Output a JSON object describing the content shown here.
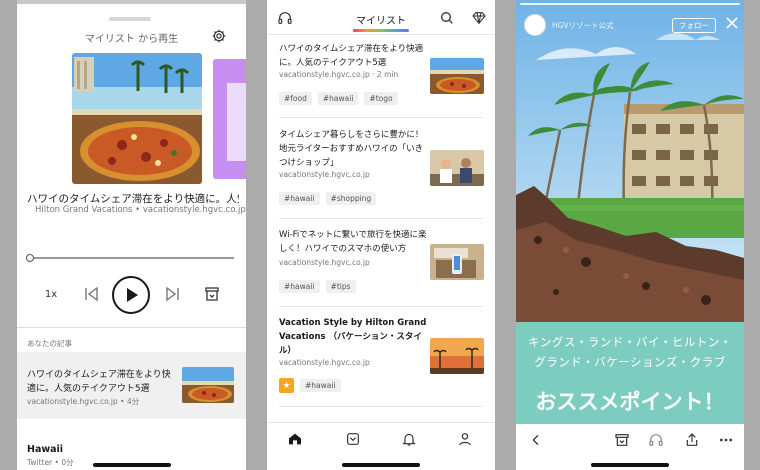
{
  "player": {
    "header_title": "マイリスト から再生",
    "track_title": "ハワイのタイムシェア滞在をより快適に。人気…",
    "track_source": "Hilton Grand Vacations • vacationstyle.hgvc.co.jp",
    "playback_fraction": 0.0,
    "speed_label": "1x",
    "section_label": "あなたの記事",
    "current_item": {
      "title": "ハワイのタイムシェア滞在をより快適に。人気のテイクアウト5選",
      "meta": "vacationstyle.hgvc.co.jp • 4分"
    },
    "next_item": {
      "title": "Hawaii",
      "meta": "Twitter • 0分"
    }
  },
  "list": {
    "title": "マイリスト",
    "items": [
      {
        "title": "ハワイのタイムシェア滞在をより快適に。人気のテイクアウト5選",
        "meta": "vacationstyle.hgvc.co.jp · 2 min",
        "tags": [
          "#food",
          "#hawaii",
          "#togo"
        ]
      },
      {
        "title": "タイムシェア暮らしをさらに豊かに！地元ライターおすすめハワイの「いきつけショップ」",
        "meta": "vacationstyle.hgvc.co.jp",
        "tags": [
          "#hawaii",
          "#shopping"
        ]
      },
      {
        "title": "Wi-Fiでネットに繋いで旅行を快適に楽しく！ハワイでのスマホの使い方",
        "meta": "vacationstyle.hgvc.co.jp",
        "tags": [
          "#hawaii",
          "#tips"
        ]
      },
      {
        "title": "Vacation Style by Hilton Grand Vacations （バケーション・スタイル）",
        "meta": "vacationstyle.hgvc.co.jp",
        "tags": [
          "#hawaii"
        ]
      }
    ]
  },
  "story": {
    "account_name": "HGVリゾート公式",
    "follow_label": "フォロー",
    "banner_line1": "キングス・ランド・バイ・ヒルトン・",
    "banner_line2": "グランド・バケーションズ・クラブ",
    "banner_headline": "おススメポイント！"
  },
  "colors": {
    "banner": "#7ccdc0",
    "tag_bg": "#efefef",
    "favorite_star": "#f6a623",
    "art_next": "#c58ef0"
  }
}
